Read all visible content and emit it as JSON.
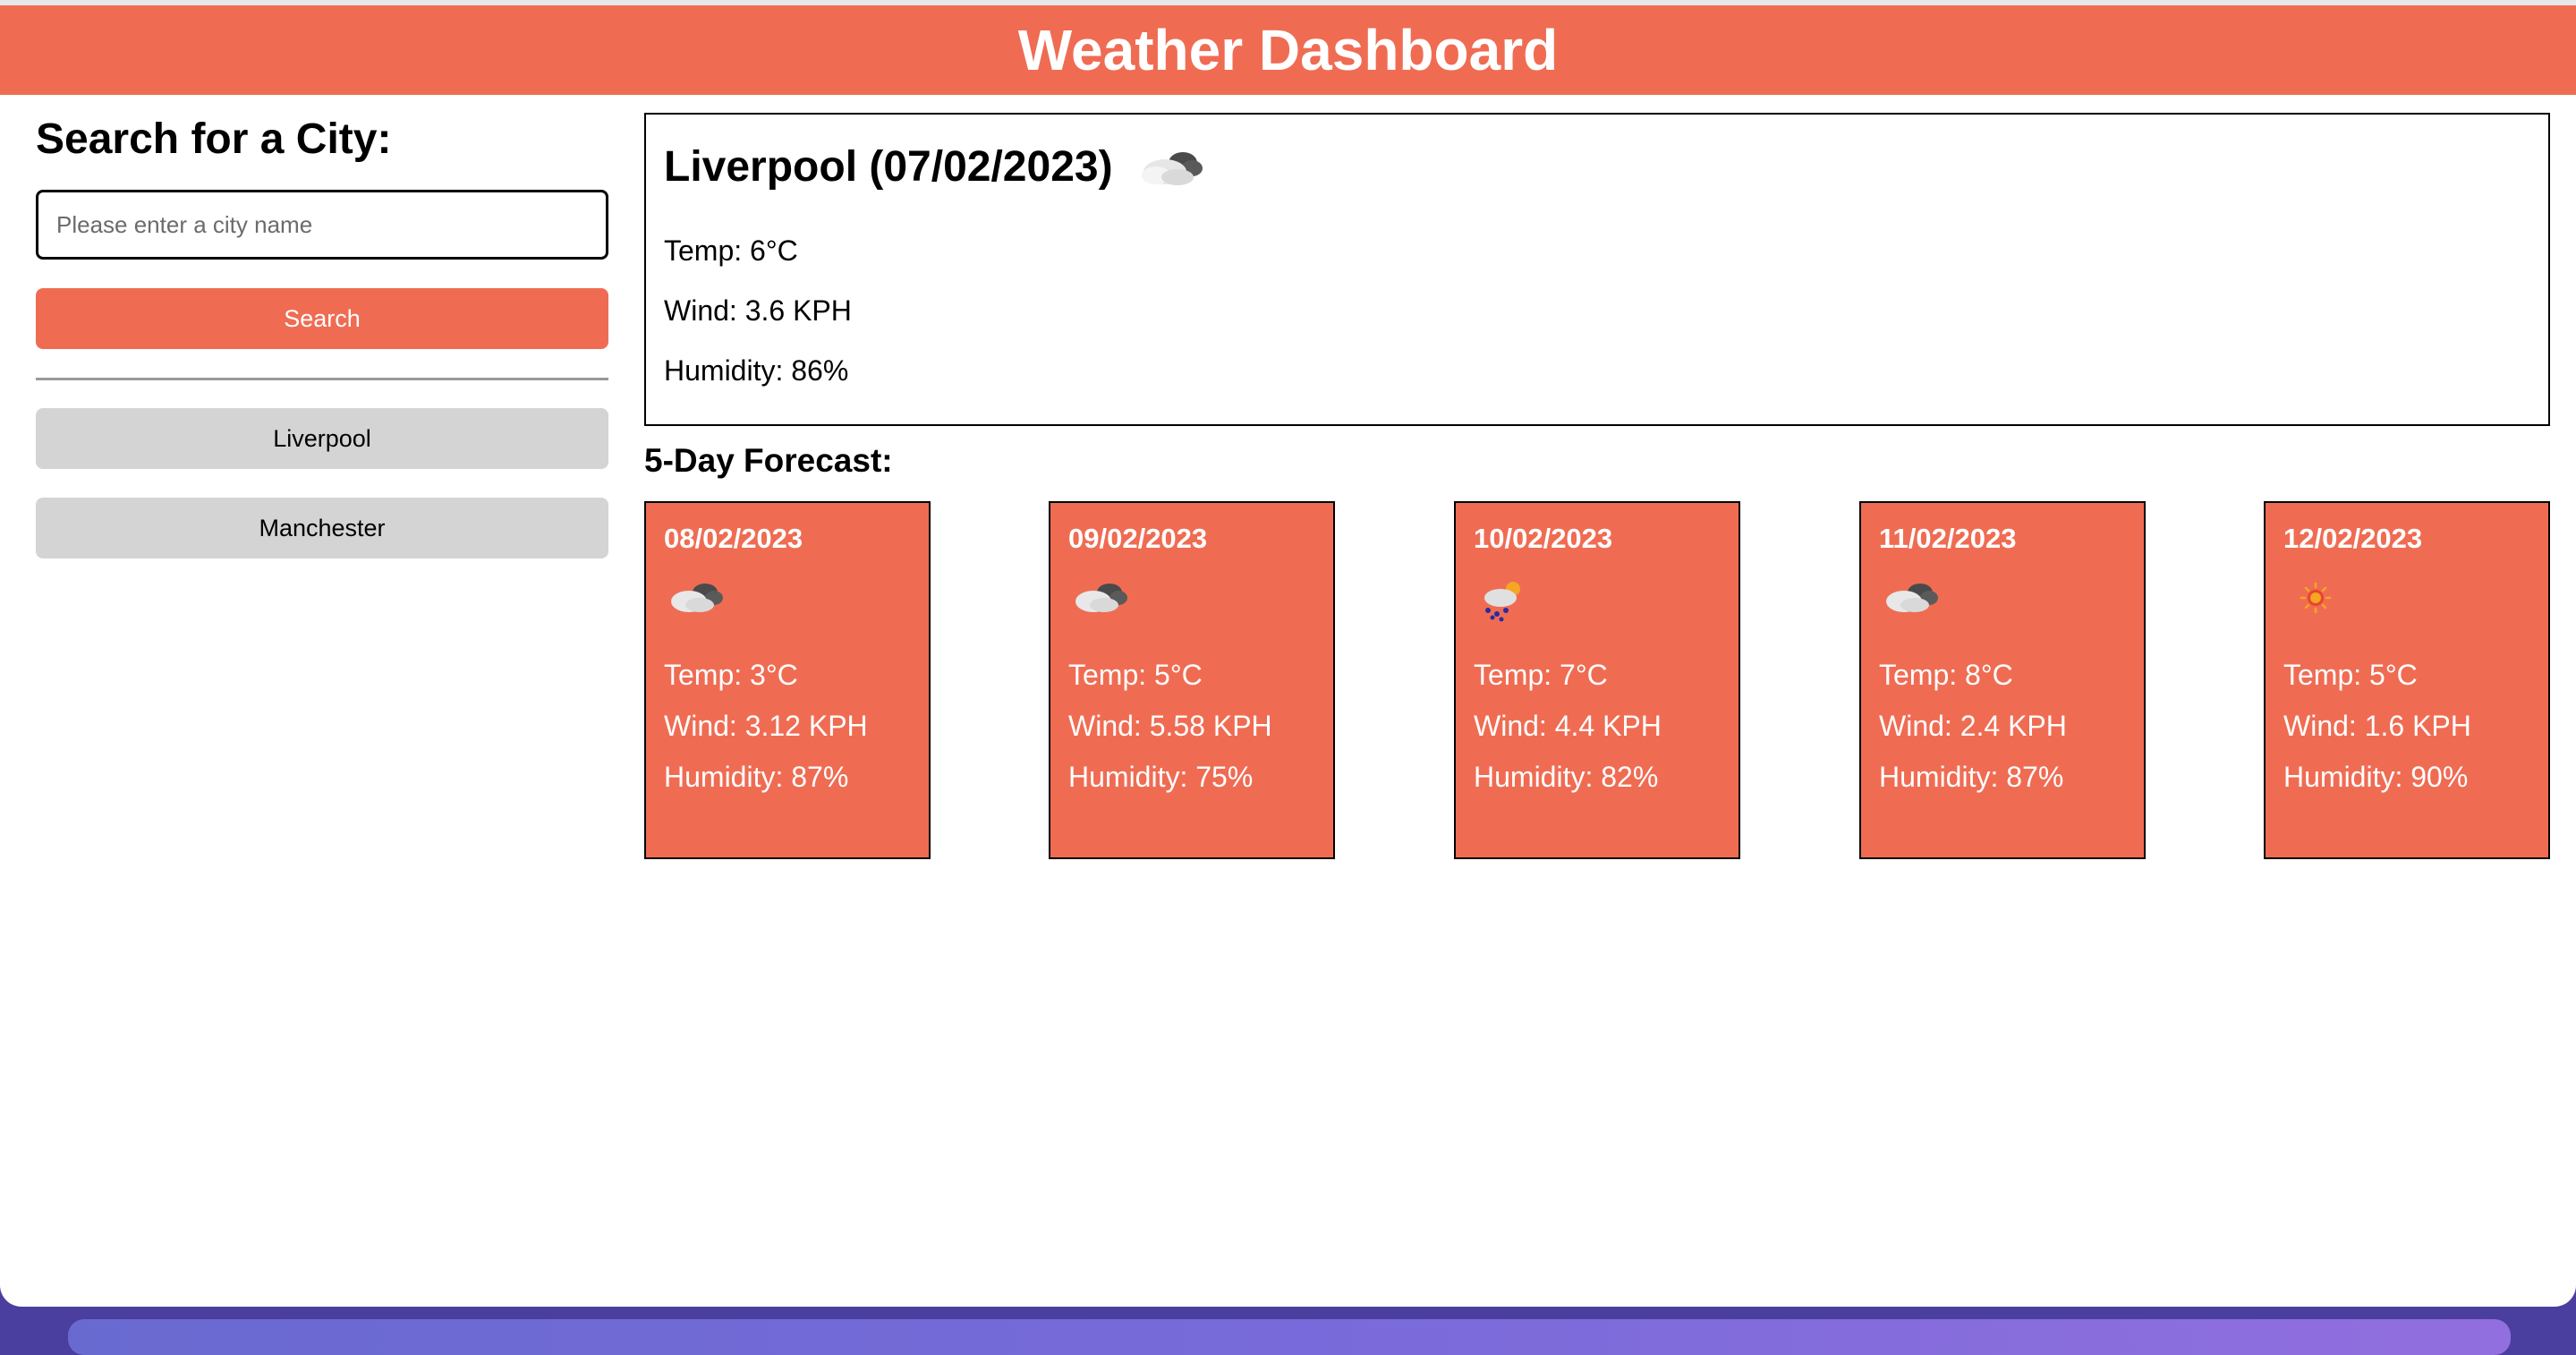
{
  "header": {
    "title": "Weather Dashboard"
  },
  "sidebar": {
    "heading": "Search for a City:",
    "search": {
      "placeholder": "Please enter a city name",
      "value": ""
    },
    "search_button_label": "Search",
    "history": [
      "Liverpool",
      "Manchester"
    ]
  },
  "current": {
    "title": "Liverpool (07/02/2023)",
    "icon": "cloudy-icon",
    "temp": "Temp: 6°C",
    "wind": "Wind: 3.6 KPH",
    "humidity": "Humidity: 86%"
  },
  "forecast": {
    "title": "5-Day Forecast:",
    "days": [
      {
        "date": "08/02/2023",
        "icon": "cloudy-icon",
        "temp": "Temp: 3°C",
        "wind": "Wind: 3.12 KPH",
        "humidity": "Humidity: 87%"
      },
      {
        "date": "09/02/2023",
        "icon": "cloudy-icon",
        "temp": "Temp: 5°C",
        "wind": "Wind: 5.58 KPH",
        "humidity": "Humidity: 75%"
      },
      {
        "date": "10/02/2023",
        "icon": "rain-sun-icon",
        "temp": "Temp: 7°C",
        "wind": "Wind: 4.4 KPH",
        "humidity": "Humidity: 82%"
      },
      {
        "date": "11/02/2023",
        "icon": "cloudy-icon",
        "temp": "Temp: 8°C",
        "wind": "Wind: 2.4 KPH",
        "humidity": "Humidity: 87%"
      },
      {
        "date": "12/02/2023",
        "icon": "sun-icon",
        "temp": "Temp: 5°C",
        "wind": "Wind: 1.6 KPH",
        "humidity": "Humidity: 90%"
      }
    ]
  },
  "colors": {
    "accent": "#ef6c53",
    "history_button": "#d4d4d4"
  }
}
